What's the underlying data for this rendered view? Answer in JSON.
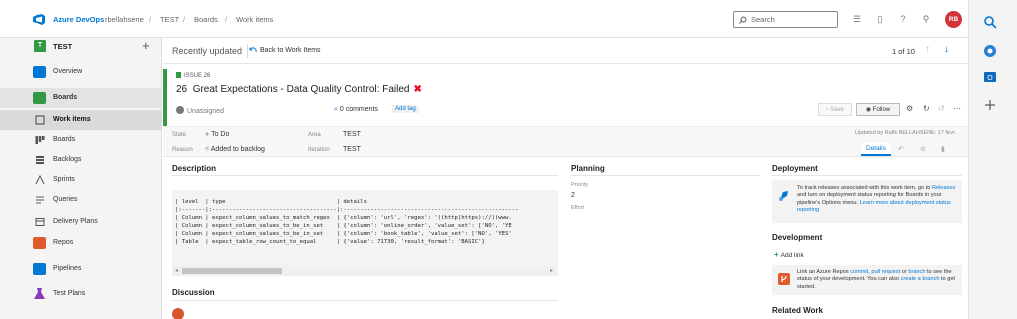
{
  "topbar": {
    "brand": "Azure DevOps",
    "org": "rbellahsene",
    "breadcrumb": [
      "TEST",
      "Boards",
      "Work items"
    ],
    "search_placeholder": "Search",
    "avatar_initials": "RB"
  },
  "sidebar": {
    "project_badge": "T",
    "project_name": "TEST",
    "items": [
      {
        "label": "Overview",
        "icon": "overview-icon",
        "color": "#0078d4"
      },
      {
        "label": "Boards",
        "icon": "boards-icon",
        "color": "#339947"
      },
      {
        "label": "Work items",
        "icon": "work-items-icon"
      },
      {
        "label": "Boards",
        "icon": "boards-sub-icon"
      },
      {
        "label": "Backlogs",
        "icon": "backlogs-icon"
      },
      {
        "label": "Sprints",
        "icon": "sprints-icon"
      },
      {
        "label": "Queries",
        "icon": "queries-icon"
      },
      {
        "label": "Delivery Plans",
        "icon": "delivery-plans-icon"
      },
      {
        "label": "Repos",
        "icon": "repos-icon",
        "color": "#e05a2b"
      },
      {
        "label": "Pipelines",
        "icon": "pipelines-icon",
        "color": "#0078d4"
      },
      {
        "label": "Test Plans",
        "icon": "test-plans-icon",
        "color": "#8a3ab9"
      }
    ]
  },
  "header": {
    "recent": "Recently updated",
    "back": "Back to Work Items",
    "pager": "1 of 10"
  },
  "work_item": {
    "type": "ISSUE 26",
    "id": "26",
    "title": "Great Expectations - Data Quality Control: Failed",
    "status_icon": "✖",
    "assigned": "Unassigned",
    "comments": "0 comments",
    "add_tag": "Add tag",
    "save": "Save",
    "follow": "Follow",
    "state_label": "State",
    "state": "To Do",
    "reason_label": "Reason",
    "reason": "Added to backlog",
    "area_label": "Area",
    "area": "TEST",
    "iteration_label": "Iteration",
    "iteration": "TEST",
    "updated": "Updated by Rafik BELLAHSENE: 17 févr.",
    "details_tab": "Details"
  },
  "description": {
    "title": "Description",
    "lines": [
      "| level  | type                                 | details",
      "|:-------|:-------------------------------------|:----------------------------------------------------",
      "| Column | expect_column_values_to_match_regex  | {'column': 'url', 'regex': '((http|https)://)(www.",
      "| Column | expect_column_values_to_be_in_set    | {'column': 'online_order', 'value_set': ['NO', 'YE",
      "| Column | expect_column_values_to_be_in_set    | {'column': 'book_table', 'value_set': ['NO', 'YES'",
      "| Table  | expect_table_row_count_to_equal      | {'value': 71730, 'result_format': 'BASIC'}"
    ]
  },
  "discussion": {
    "title": "Discussion"
  },
  "planning": {
    "title": "Planning",
    "priority_label": "Priority",
    "priority": "2",
    "effort_label": "Effort"
  },
  "deployment": {
    "title": "Deployment",
    "text_a": "To track releases associated with this work item, go to ",
    "link_releases": "Releases",
    "text_b": " and turn on deployment status reporting for Boards in your pipeline's Options menu. ",
    "link_learn": "Learn more about deployment status reporting"
  },
  "development": {
    "title": "Development",
    "add_link": "Add link",
    "text_a": "Link an Azure Repos ",
    "link_commit": "commit",
    "sep1": ", ",
    "link_pr": "pull request",
    "sep2": " or ",
    "link_branch": "branch",
    "text_b": " to see the status of your development. You can also ",
    "link_create": "create a branch",
    "text_c": " to get started."
  },
  "related": {
    "title": "Related Work"
  }
}
